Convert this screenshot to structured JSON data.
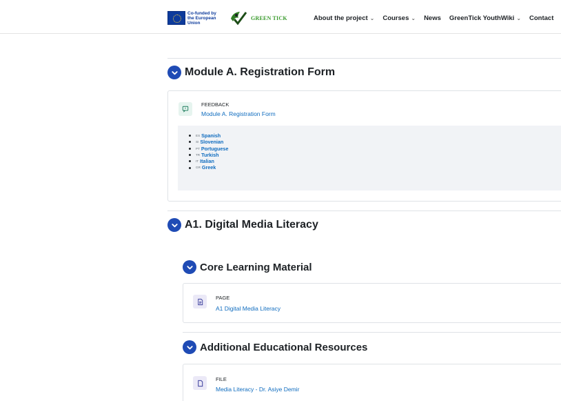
{
  "header": {
    "eu_text": "Co-funded by the European Union",
    "logo_text": "GREEN TICK",
    "nav": [
      {
        "label": "About the project",
        "has_menu": true
      },
      {
        "label": "Courses",
        "has_menu": true
      },
      {
        "label": "News",
        "has_menu": false
      },
      {
        "label": "GreenTick YouthWiki",
        "has_menu": true
      },
      {
        "label": "Contact",
        "has_menu": false
      }
    ]
  },
  "colors": {
    "accent": "#1f4bb5",
    "link": "#0f6cbf",
    "feedback_icon_bg": "#e6f4ef",
    "page_icon_bg": "#ebe9f7"
  },
  "module_a": {
    "title": "Module A. Registration Form",
    "activity": {
      "type": "FEEDBACK",
      "name": "Module A. Registration Form",
      "icon": "feedback-icon"
    },
    "languages": [
      {
        "code": "ES",
        "name": "Spanish"
      },
      {
        "code": "SI",
        "name": "Slovenian"
      },
      {
        "code": "PT",
        "name": "Portuguese"
      },
      {
        "code": "TR",
        "name": "Turkish"
      },
      {
        "code": "IT",
        "name": "Italian"
      },
      {
        "code": "GR",
        "name": "Greek"
      }
    ]
  },
  "a1": {
    "title": "A1. Digital Media Literacy",
    "core": {
      "title": "Core Learning Material",
      "activity": {
        "type": "PAGE",
        "name": "A1 Digital Media Literacy",
        "icon": "page-icon"
      }
    },
    "additional": {
      "title": "Additional Educational Resources",
      "activity": {
        "type": "FILE",
        "name": "Media Literacy - Dr. Asiye Demir",
        "icon": "file-icon"
      }
    }
  }
}
